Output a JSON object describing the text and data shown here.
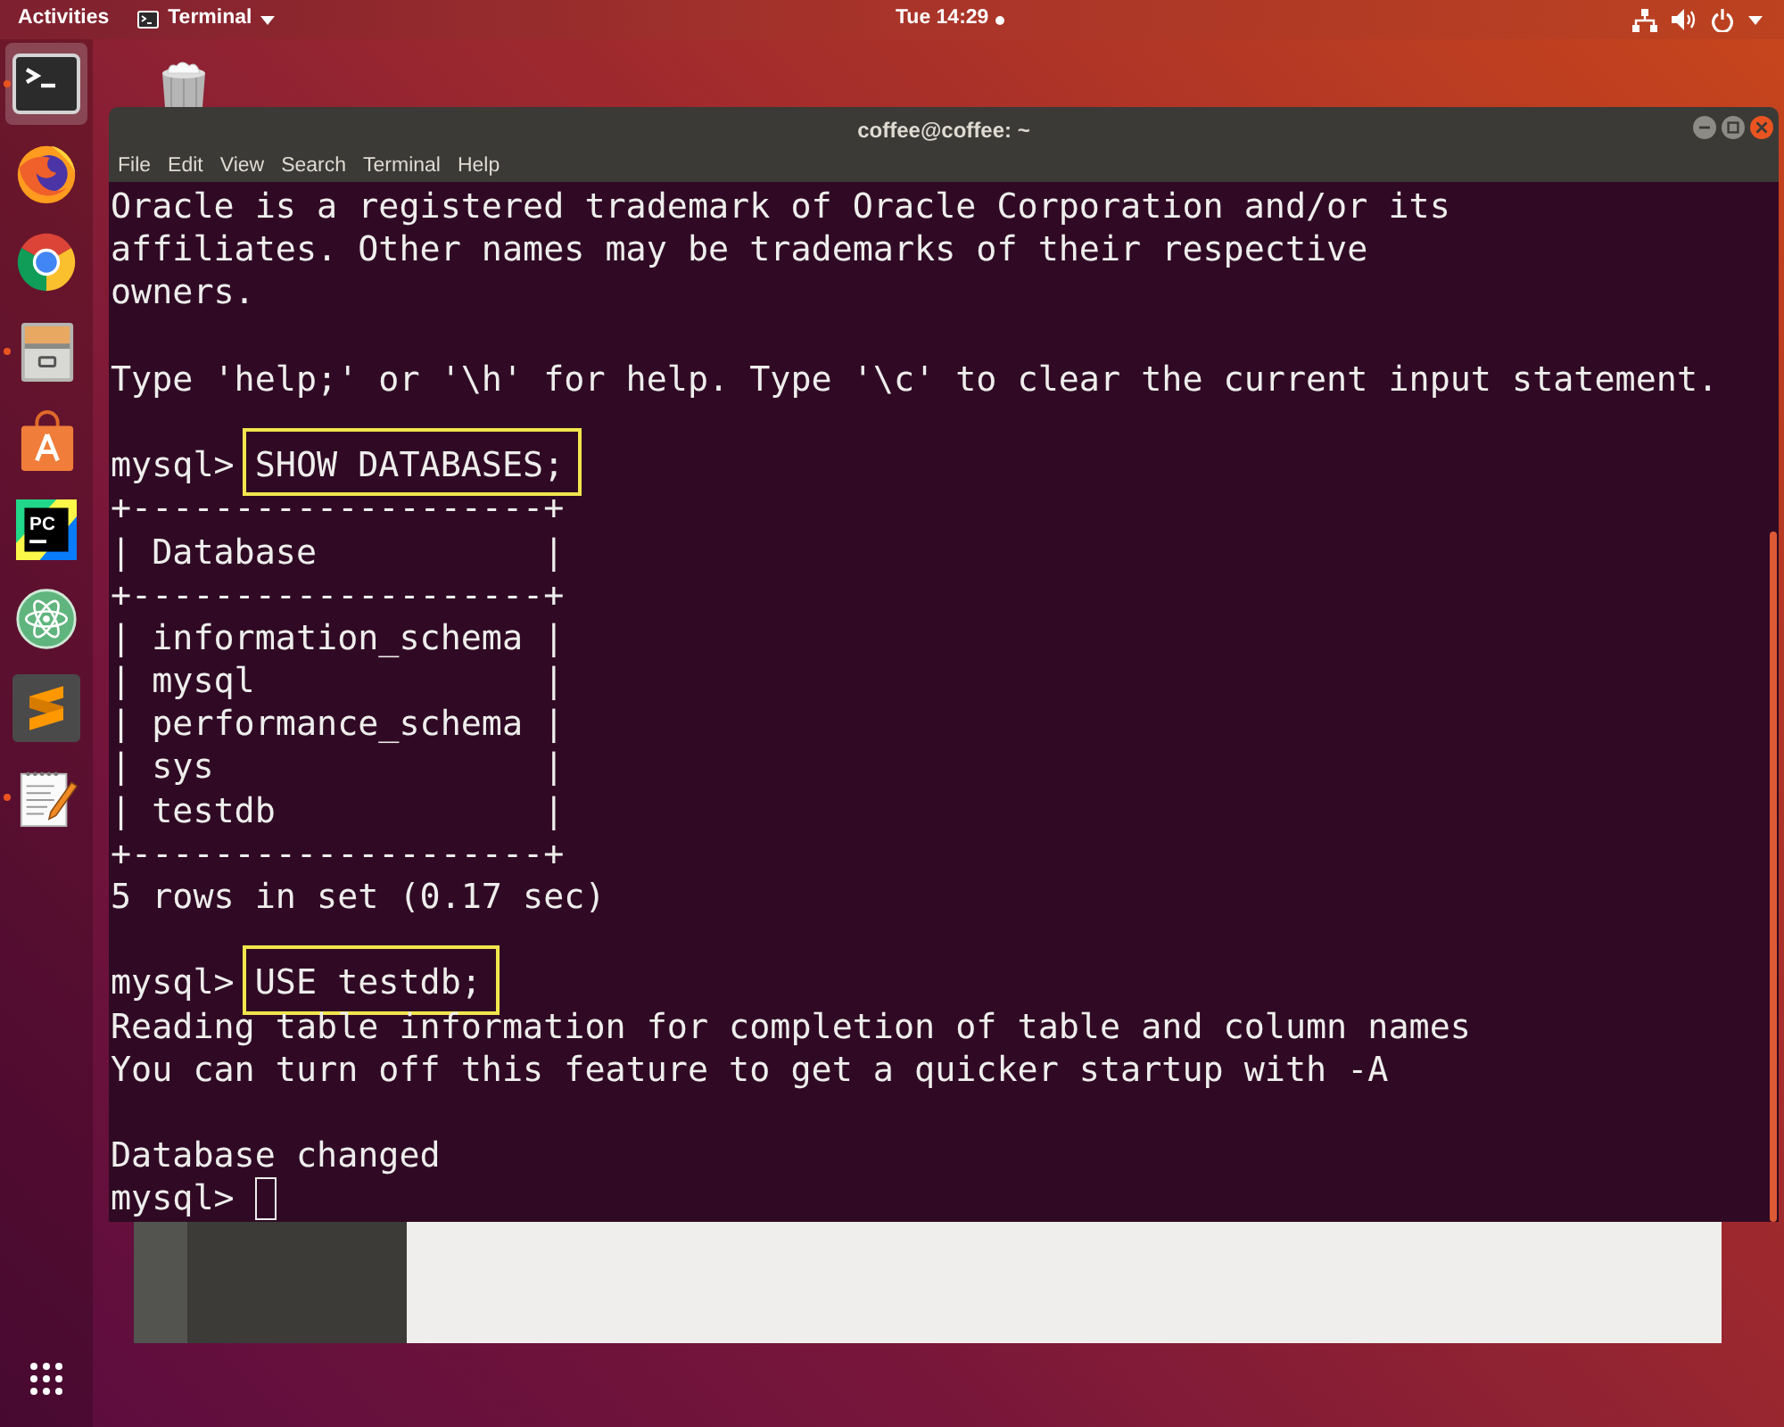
{
  "top_bar": {
    "activities": "Activities",
    "app_menu": "Terminal",
    "clock": {
      "text": "Tue 14:29",
      "notification": true
    }
  },
  "dock": {
    "items": [
      {
        "kind": "terminal",
        "running": true,
        "selected": true
      },
      {
        "kind": "foxglobe",
        "running": false,
        "selected": false
      },
      {
        "kind": "segmented",
        "running": false,
        "selected": false
      },
      {
        "kind": "cabinet",
        "running": true,
        "selected": false
      },
      {
        "kind": "bag",
        "running": false,
        "selected": false
      },
      {
        "kind": "pclogo",
        "logo_text": "PC",
        "running": false,
        "selected": false
      },
      {
        "kind": "atom",
        "running": false,
        "selected": false
      },
      {
        "kind": "zigzag",
        "running": false,
        "selected": false
      },
      {
        "kind": "notepad",
        "running": true,
        "selected": false
      }
    ]
  },
  "terminal": {
    "title": "coffee@coffee: ~",
    "menu": [
      "File",
      "Edit",
      "View",
      "Search",
      "Terminal",
      "Help"
    ],
    "lines": [
      {
        "kind": "output",
        "text": "Oracle is a registered trademark of Oracle Corporation and/or its"
      },
      {
        "kind": "output",
        "text": "affiliates. Other names may be trademarks of their respective"
      },
      {
        "kind": "output",
        "text": "owners."
      },
      {
        "kind": "blank"
      },
      {
        "kind": "output",
        "text": "Type 'help;' or '\\h' for help. Type '\\c' to clear the current input statement."
      },
      {
        "kind": "blank"
      },
      {
        "kind": "prompt",
        "prompt": "mysql>",
        "command": "SHOW DATABASES;",
        "highlighted": true,
        "cursor": false
      },
      {
        "kind": "output",
        "text": "+--------------------+"
      },
      {
        "kind": "output",
        "text": "| Database           |"
      },
      {
        "kind": "output",
        "text": "+--------------------+"
      },
      {
        "kind": "output",
        "text": "| information_schema |"
      },
      {
        "kind": "output",
        "text": "| mysql              |"
      },
      {
        "kind": "output",
        "text": "| performance_schema |"
      },
      {
        "kind": "output",
        "text": "| sys                |"
      },
      {
        "kind": "output",
        "text": "| testdb             |"
      },
      {
        "kind": "output",
        "text": "+--------------------+"
      },
      {
        "kind": "output",
        "text": "5 rows in set (0.17 sec)"
      },
      {
        "kind": "blank"
      },
      {
        "kind": "prompt",
        "prompt": "mysql>",
        "command": "USE testdb;",
        "highlighted": true,
        "cursor": false
      },
      {
        "kind": "output",
        "text": "Reading table information for completion of table and column names"
      },
      {
        "kind": "output",
        "text": "You can turn off this feature to get a quicker startup with -A"
      },
      {
        "kind": "blank"
      },
      {
        "kind": "output",
        "text": "Database changed"
      },
      {
        "kind": "prompt",
        "prompt": "mysql>",
        "highlighted": false,
        "cursor": true
      }
    ]
  }
}
